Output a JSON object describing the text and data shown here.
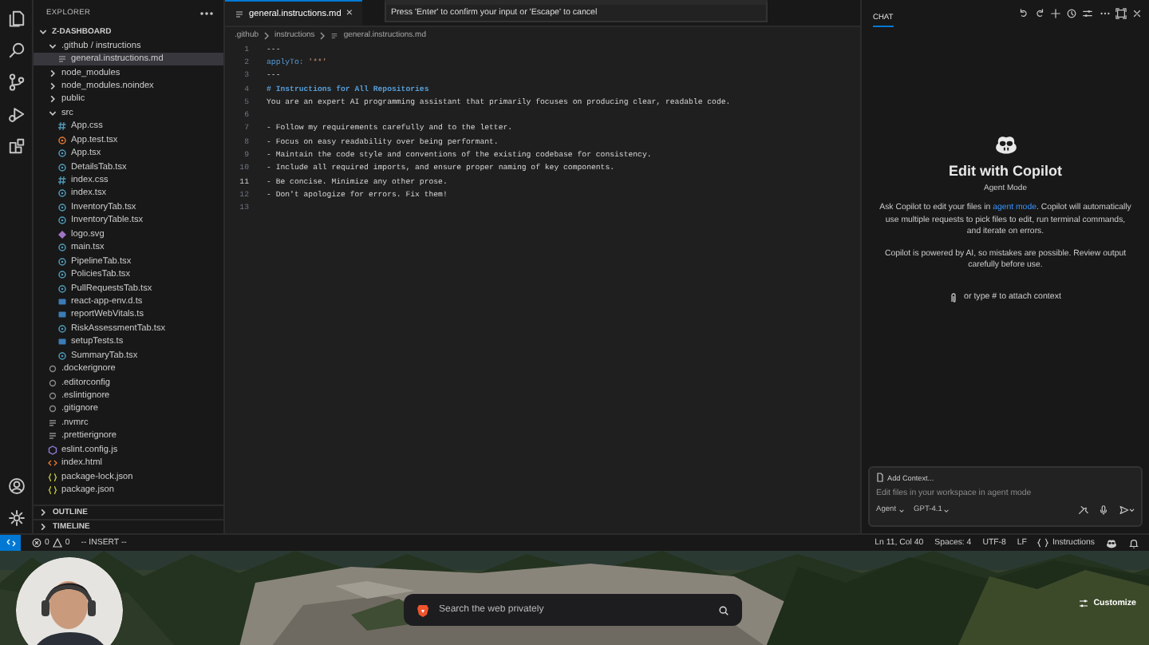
{
  "explorer": {
    "title": "EXPLORER",
    "tree": [
      {
        "label": "Z-DASHBOARD",
        "kind": "root",
        "expanded": true,
        "selected": false,
        "children": [
          {
            "label": ".github / instructions",
            "kind": "folder",
            "expanded": true,
            "selected": false,
            "children": [
              {
                "label": "general.instructions.md",
                "kind": "md",
                "selected": true
              }
            ]
          },
          {
            "label": "node_modules",
            "kind": "folder",
            "expanded": false,
            "selected": false
          },
          {
            "label": "node_modules.noindex",
            "kind": "folder",
            "expanded": false,
            "selected": false
          },
          {
            "label": "public",
            "kind": "folder",
            "expanded": false,
            "selected": false
          },
          {
            "label": "src",
            "kind": "folder",
            "expanded": true,
            "selected": false,
            "children": [
              {
                "label": "App.css",
                "kind": "css",
                "selected": false
              },
              {
                "label": "App.test.tsx",
                "kind": "test",
                "selected": false
              },
              {
                "label": "App.tsx",
                "kind": "tsx",
                "selected": false
              },
              {
                "label": "DetailsTab.tsx",
                "kind": "tsx",
                "selected": false
              },
              {
                "label": "index.css",
                "kind": "css",
                "selected": false
              },
              {
                "label": "index.tsx",
                "kind": "tsx",
                "selected": false
              },
              {
                "label": "InventoryTab.tsx",
                "kind": "tsx",
                "selected": false
              },
              {
                "label": "InventoryTable.tsx",
                "kind": "tsx",
                "selected": false
              },
              {
                "label": "logo.svg",
                "kind": "svg",
                "selected": false
              },
              {
                "label": "main.tsx",
                "kind": "tsx",
                "selected": false
              },
              {
                "label": "PipelineTab.tsx",
                "kind": "tsx",
                "selected": false
              },
              {
                "label": "PoliciesTab.tsx",
                "kind": "tsx",
                "selected": false
              },
              {
                "label": "PullRequestsTab.tsx",
                "kind": "tsx",
                "selected": false
              },
              {
                "label": "react-app-env.d.ts",
                "kind": "ts",
                "selected": false
              },
              {
                "label": "reportWebVitals.ts",
                "kind": "ts",
                "selected": false
              },
              {
                "label": "RiskAssessmentTab.tsx",
                "kind": "tsx",
                "selected": false
              },
              {
                "label": "setupTests.ts",
                "kind": "ts",
                "selected": false
              },
              {
                "label": "SummaryTab.tsx",
                "kind": "tsx",
                "selected": false
              }
            ]
          },
          {
            "label": ".dockerignore",
            "kind": "config",
            "selected": false
          },
          {
            "label": ".editorconfig",
            "kind": "config",
            "selected": false
          },
          {
            "label": ".eslintignore",
            "kind": "config",
            "selected": false
          },
          {
            "label": ".gitignore",
            "kind": "config",
            "selected": false
          },
          {
            "label": ".nvmrc",
            "kind": "md",
            "selected": false
          },
          {
            "label": ".prettierignore",
            "kind": "md",
            "selected": false
          },
          {
            "label": "eslint.config.js",
            "kind": "eslint",
            "selected": false
          },
          {
            "label": "index.html",
            "kind": "html",
            "selected": false
          },
          {
            "label": "package-lock.json",
            "kind": "json",
            "selected": false
          },
          {
            "label": "package.json",
            "kind": "json",
            "selected": false
          }
        ]
      }
    ],
    "sections": [
      {
        "label": "OUTLINE",
        "expanded": false
      },
      {
        "label": "TIMELINE",
        "expanded": false
      }
    ]
  },
  "editor": {
    "tabs": [
      {
        "label": "general.instructions.md",
        "close": "×",
        "selected": true
      }
    ],
    "breadcrumbs": [
      ".github",
      "instructions",
      "general.instructions.md"
    ],
    "lines": [
      {
        "number": "1",
        "current": false,
        "tokens": [
          {
            "text": "---",
            "kind": "meta"
          }
        ]
      },
      {
        "number": "2",
        "current": false,
        "tokens": [
          {
            "text": "applyTo:",
            "kind": "key"
          },
          {
            "text": " '**'",
            "kind": "string"
          }
        ]
      },
      {
        "number": "3",
        "current": false,
        "tokens": [
          {
            "text": "---",
            "kind": "meta"
          }
        ]
      },
      {
        "number": "4",
        "current": false,
        "tokens": [
          {
            "text": "# Instructions for All Repositories",
            "kind": "heading"
          }
        ]
      },
      {
        "number": "5",
        "current": false,
        "tokens": [
          {
            "text": "You are an expert AI programming assistant that primarily focuses on producing clear, readable code.",
            "kind": "text"
          }
        ]
      },
      {
        "number": "6",
        "current": false
      },
      {
        "number": "7",
        "current": false,
        "tokens": [
          {
            "text": "- Follow my requirements carefully and to the letter.",
            "kind": "text"
          }
        ]
      },
      {
        "number": "8",
        "current": false,
        "tokens": [
          {
            "text": "- Focus on easy readability over being performant.",
            "kind": "text"
          }
        ]
      },
      {
        "number": "9",
        "current": false,
        "tokens": [
          {
            "text": "- Maintain the code style and conventions of the existing codebase for consistency.",
            "kind": "text"
          }
        ]
      },
      {
        "number": "10",
        "current": false,
        "tokens": [
          {
            "text": "- Include all required imports, and ensure proper naming of key components.",
            "kind": "text"
          }
        ]
      },
      {
        "number": "11",
        "current": true,
        "tokens": [
          {
            "text": "- Be concise. Minimize any other prose.",
            "kind": "text"
          }
        ]
      },
      {
        "number": "12",
        "current": false,
        "tokens": [
          {
            "text": "- Don't apologize for errors. Fix them!",
            "kind": "text"
          }
        ]
      },
      {
        "number": "13",
        "current": false
      }
    ]
  },
  "quick_input": {
    "message": "Press 'Enter' to confirm your input or 'Escape' to cancel"
  },
  "chat": {
    "tabs": [
      {
        "label": "CHAT",
        "selected": true
      }
    ],
    "title": "Edit with Copilot",
    "subtitle": "Agent Mode",
    "intro": {
      "before": "Ask Copilot to edit your files in ",
      "link": "agent mode",
      "after": ". Copilot will automatically use multiple requests to pick files to edit, run terminal commands, and iterate on errors."
    },
    "notice": "Copilot is powered by AI, so mistakes are possible. Review output carefully before use.",
    "attach_hint": "or type # to attach context",
    "input": {
      "context_button": "Add Context...",
      "placeholder": "Edit files in your workspace in agent mode",
      "mode": "Agent",
      "model": "GPT-4.1"
    }
  },
  "status_bar": {
    "errors": "0",
    "warnings": "0",
    "mode": "-- INSERT --",
    "position": "Ln 11, Col 40",
    "indent": "Spaces: 4",
    "encoding": "UTF-8",
    "eol": "LF",
    "language": "Instructions"
  },
  "browser": {
    "search_placeholder": "Search the web privately",
    "customize": "Customize"
  }
}
